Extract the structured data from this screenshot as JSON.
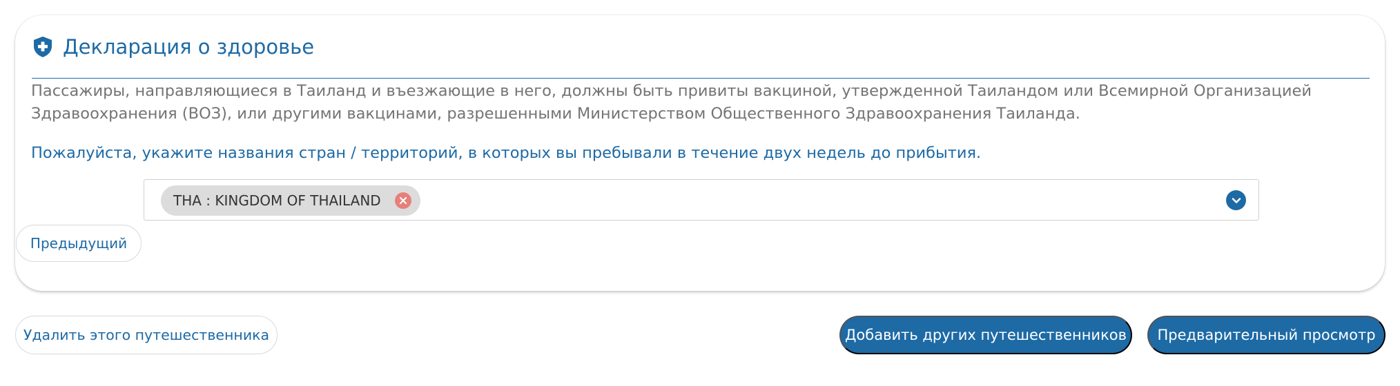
{
  "section": {
    "title": "Декларация о здоровье",
    "description": "Пассажиры, направляющиеся в Таиланд и въезжающие в него, должны быть привиты вакциной, утвержденной Таиландом или Всемирной Организацией Здравоохранения (ВОЗ), или другими вакцинами, разрешенными Министерством Общественного Здравоохранения Таиланда.",
    "instruction": "Пожалуйста, укажите названия стран / территорий, в которых вы пребывали в течение двух недель до прибытия.",
    "icon": "shield-plus-icon"
  },
  "countries": {
    "selected": [
      {
        "label": "THA : KINGDOM OF THAILAND"
      }
    ]
  },
  "buttons": {
    "previous": "Предыдущий",
    "remove_traveler": "Удалить этого путешественника",
    "add_travelers": "Добавить других путешественников",
    "preview": "Предварительный просмотр"
  },
  "colors": {
    "primary": "#1d6aa5",
    "text_muted": "#747474",
    "tag_bg": "#dcdcdc",
    "tag_remove": "#e87f7a"
  }
}
